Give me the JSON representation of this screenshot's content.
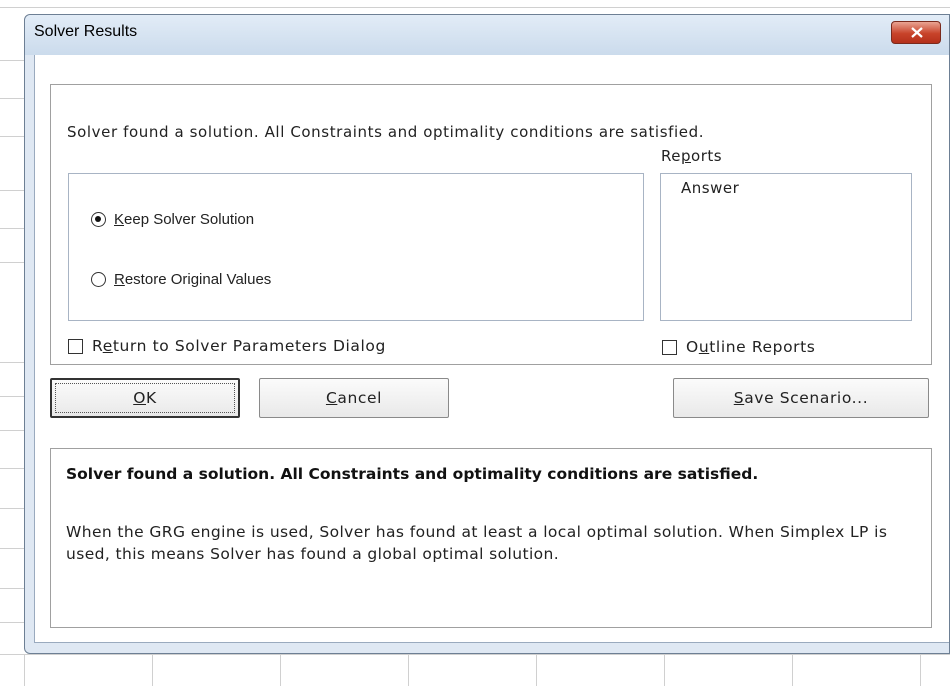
{
  "window": {
    "title": "Solver Results",
    "close_icon": "close-x-icon"
  },
  "message": "Solver found a solution.  All Constraints and optimality conditions are satisfied.",
  "options": {
    "keep": {
      "hot": "K",
      "rest": "eep Solver Solution",
      "selected": true
    },
    "restore": {
      "hot": "R",
      "rest": "estore Original Values",
      "selected": false
    }
  },
  "reports": {
    "label_pre": "Re",
    "label_hot": "p",
    "label_post": "orts",
    "items": [
      "Answer"
    ]
  },
  "checks": {
    "return_dialog": {
      "pre": "R",
      "hot": "e",
      "post": "turn to Solver Parameters Dialog",
      "checked": false
    },
    "outline_reports": {
      "pre": "O",
      "hot": "u",
      "post": "tline Reports",
      "checked": false
    }
  },
  "buttons": {
    "ok": {
      "hot": "O",
      "rest": "K"
    },
    "cancel": {
      "hot": "C",
      "rest": "ancel"
    },
    "save_scenario": {
      "hot": "S",
      "rest": "ave Scenario..."
    }
  },
  "summary": {
    "bold": "Solver found a solution.  All Constraints and optimality conditions are satisfied.",
    "detail": "When the GRG engine is used, Solver has found at least a local optimal solution. When Simplex LP is used, this means Solver has found a global optimal solution."
  }
}
